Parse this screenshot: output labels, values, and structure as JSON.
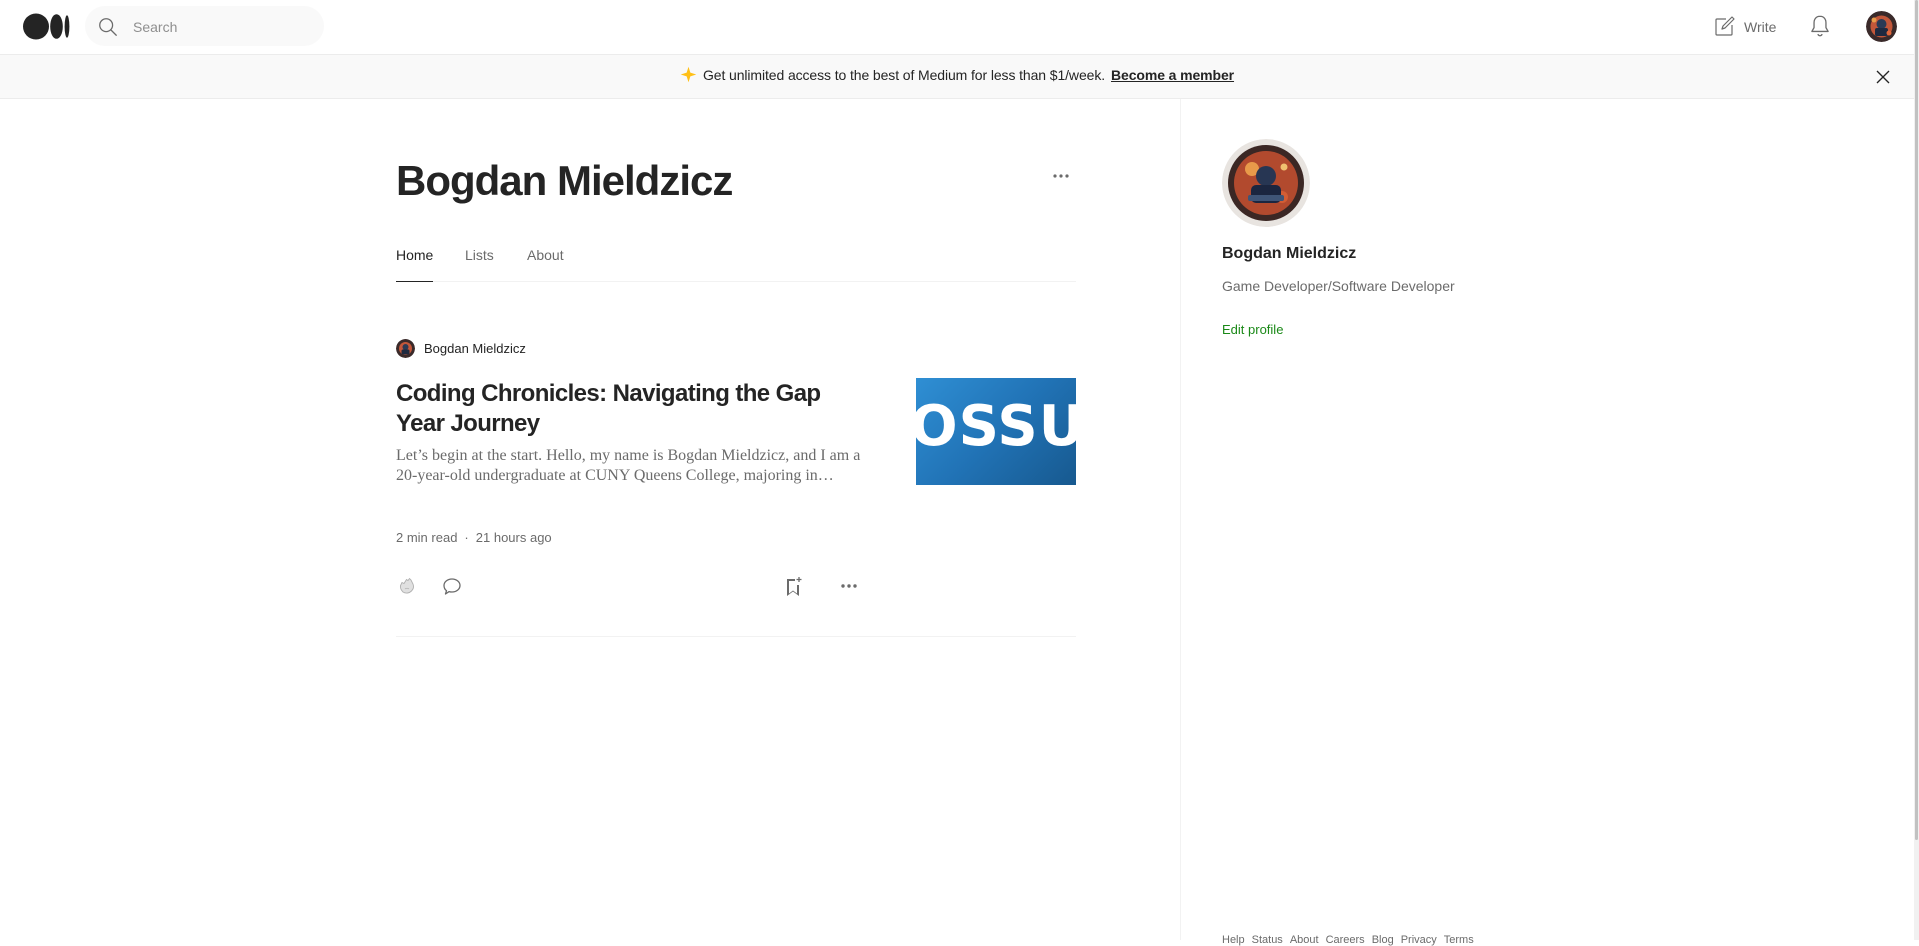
{
  "topbar": {
    "logo_icon": "medium-logo-icon",
    "search": {
      "placeholder": "Search",
      "value": ""
    },
    "write_label": "Write",
    "notifications_icon": "bell-icon"
  },
  "banner": {
    "text": "Get unlimited access to the best of Medium for less than $1/week.",
    "link": "Become a member",
    "accent": "#ffc017"
  },
  "profile": {
    "name": "Bogdan Mieldzicz",
    "tabs": [
      {
        "label": "Home",
        "active": true
      },
      {
        "label": "Lists",
        "active": false
      },
      {
        "label": "About",
        "active": false
      }
    ]
  },
  "article": {
    "author": "Bogdan Mieldzicz",
    "title": "Coding Chronicles: Navigating the Gap Year Journey",
    "snippet": "Let’s begin at the start. Hello, my name is Bogdan Mieldzicz, and I am a 20-year-old undergraduate at CUNY Queens College, majoring in…",
    "read_time": "2 min read",
    "separator": "·",
    "posted": "21 hours ago",
    "thumbnail_text": "OSSU"
  },
  "sidebar": {
    "name": "Bogdan Mieldzicz",
    "bio": "Game Developer/Software Developer",
    "edit_label": "Edit profile",
    "footer": [
      "Help",
      "Status",
      "About",
      "Careers",
      "Blog",
      "Privacy",
      "Terms"
    ]
  },
  "colors": {
    "text": "#242424",
    "muted": "#6b6b6b",
    "green": "#1a8917",
    "thumb_blue": "#2173b6"
  }
}
